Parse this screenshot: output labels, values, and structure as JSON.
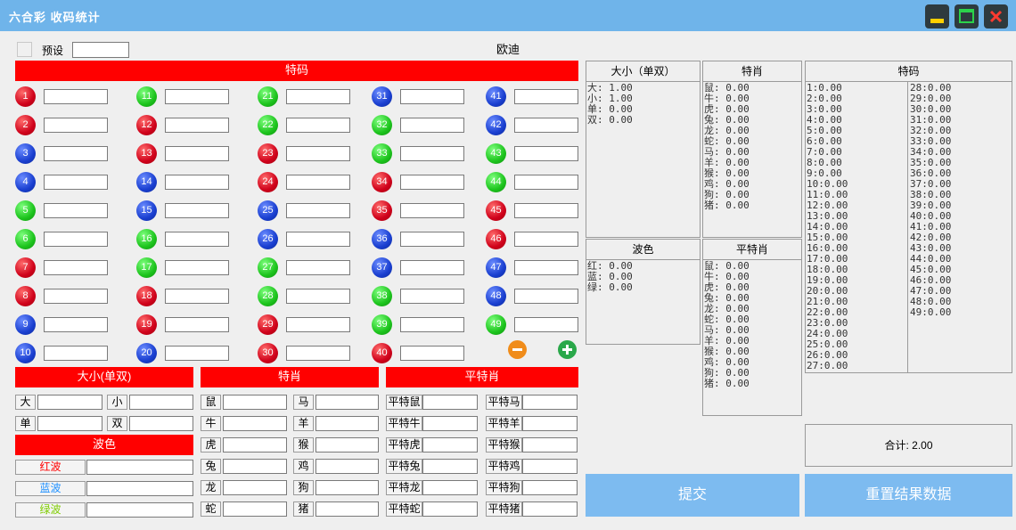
{
  "window": {
    "title": "六合彩  收码统计"
  },
  "preset": {
    "label": "预设",
    "value": ""
  },
  "name_label": "欧迪",
  "sections": {
    "tema": "特码",
    "daxiao": "大小(单双)",
    "shengxiao": "特肖",
    "pingte": "平特肖",
    "bose": "波色"
  },
  "balls": [
    {
      "n": "1",
      "c": "red"
    },
    {
      "n": "2",
      "c": "red"
    },
    {
      "n": "3",
      "c": "blue"
    },
    {
      "n": "4",
      "c": "blue"
    },
    {
      "n": "5",
      "c": "green"
    },
    {
      "n": "6",
      "c": "green"
    },
    {
      "n": "7",
      "c": "red"
    },
    {
      "n": "8",
      "c": "red"
    },
    {
      "n": "9",
      "c": "blue"
    },
    {
      "n": "10",
      "c": "blue"
    },
    {
      "n": "11",
      "c": "green"
    },
    {
      "n": "12",
      "c": "red"
    },
    {
      "n": "13",
      "c": "red"
    },
    {
      "n": "14",
      "c": "blue"
    },
    {
      "n": "15",
      "c": "blue"
    },
    {
      "n": "16",
      "c": "green"
    },
    {
      "n": "17",
      "c": "green"
    },
    {
      "n": "18",
      "c": "red"
    },
    {
      "n": "19",
      "c": "red"
    },
    {
      "n": "20",
      "c": "blue"
    },
    {
      "n": "21",
      "c": "green"
    },
    {
      "n": "22",
      "c": "green"
    },
    {
      "n": "23",
      "c": "red"
    },
    {
      "n": "24",
      "c": "red"
    },
    {
      "n": "25",
      "c": "blue"
    },
    {
      "n": "26",
      "c": "blue"
    },
    {
      "n": "27",
      "c": "green"
    },
    {
      "n": "28",
      "c": "green"
    },
    {
      "n": "29",
      "c": "red"
    },
    {
      "n": "30",
      "c": "red"
    },
    {
      "n": "31",
      "c": "blue"
    },
    {
      "n": "32",
      "c": "green"
    },
    {
      "n": "33",
      "c": "green"
    },
    {
      "n": "34",
      "c": "red"
    },
    {
      "n": "35",
      "c": "red"
    },
    {
      "n": "36",
      "c": "blue"
    },
    {
      "n": "37",
      "c": "blue"
    },
    {
      "n": "38",
      "c": "green"
    },
    {
      "n": "39",
      "c": "green"
    },
    {
      "n": "40",
      "c": "red"
    },
    {
      "n": "41",
      "c": "blue"
    },
    {
      "n": "42",
      "c": "blue"
    },
    {
      "n": "43",
      "c": "green"
    },
    {
      "n": "44",
      "c": "green"
    },
    {
      "n": "45",
      "c": "red"
    },
    {
      "n": "46",
      "c": "red"
    },
    {
      "n": "47",
      "c": "blue"
    },
    {
      "n": "48",
      "c": "blue"
    },
    {
      "n": "49",
      "c": "green"
    }
  ],
  "daxiao_items": [
    "大",
    "小",
    "单",
    "双"
  ],
  "bose_items": [
    {
      "label": "红波",
      "color": "#ff0000"
    },
    {
      "label": "蓝波",
      "color": "#1e90ff"
    },
    {
      "label": "绿波",
      "color": "#7fcc00"
    }
  ],
  "shengxiao_items": [
    "鼠",
    "马",
    "牛",
    "羊",
    "虎",
    "猴",
    "兔",
    "鸡",
    "龙",
    "狗",
    "蛇",
    "猪"
  ],
  "pingte_items": [
    "平特鼠",
    "平特马",
    "平特牛",
    "平特羊",
    "平特虎",
    "平特猴",
    "平特兔",
    "平特鸡",
    "平特龙",
    "平特狗",
    "平特蛇",
    "平特猪"
  ],
  "results": {
    "daxiao": {
      "title": "大小（单双）",
      "lines": [
        "大: 1.00",
        "小: 1.00",
        "单: 0.00",
        "双: 0.00"
      ]
    },
    "bose": {
      "title": "波色",
      "lines": [
        "红: 0.00",
        "蓝: 0.00",
        "绿: 0.00"
      ]
    },
    "texiao": {
      "title": "特肖",
      "lines": [
        "鼠: 0.00",
        "牛: 0.00",
        "虎: 0.00",
        "兔: 0.00",
        "龙: 0.00",
        "蛇: 0.00",
        "马: 0.00",
        "羊: 0.00",
        "猴: 0.00",
        "鸡: 0.00",
        "狗: 0.00",
        "猪: 0.00"
      ]
    },
    "pingtexiao": {
      "title": "平特肖",
      "lines": [
        "鼠: 0.00",
        "牛: 0.00",
        "虎: 0.00",
        "兔: 0.00",
        "龙: 0.00",
        "蛇: 0.00",
        "马: 0.00",
        "羊: 0.00",
        "猴: 0.00",
        "鸡: 0.00",
        "狗: 0.00",
        "猪: 0.00"
      ]
    },
    "tema": {
      "title": "特码",
      "col1": [
        "1:0.00",
        "2:0.00",
        "3:0.00",
        "4:0.00",
        "5:0.00",
        "6:0.00",
        "7:0.00",
        "8:0.00",
        "9:0.00",
        "10:0.00",
        "11:0.00",
        "12:0.00",
        "13:0.00",
        "14:0.00",
        "15:0.00",
        "16:0.00",
        "17:0.00",
        "18:0.00",
        "19:0.00",
        "20:0.00",
        "21:0.00",
        "22:0.00",
        "23:0.00",
        "24:0.00",
        "25:0.00",
        "26:0.00",
        "27:0.00"
      ],
      "col2": [
        "28:0.00",
        "29:0.00",
        "30:0.00",
        "31:0.00",
        "32:0.00",
        "33:0.00",
        "34:0.00",
        "35:0.00",
        "36:0.00",
        "37:0.00",
        "38:0.00",
        "39:0.00",
        "40:0.00",
        "41:0.00",
        "42:0.00",
        "43:0.00",
        "44:0.00",
        "45:0.00",
        "46:0.00",
        "47:0.00",
        "48:0.00",
        "49:0.00"
      ]
    },
    "total": "合计: 2.00"
  },
  "buttons": {
    "submit": "提交",
    "reset": "重置结果数据"
  },
  "colors": {
    "titlebar": "#6fb4ea",
    "section": "#ff0000",
    "action": "#7dbbf0",
    "minus": "#f08c1a",
    "plus": "#2aa84a"
  }
}
